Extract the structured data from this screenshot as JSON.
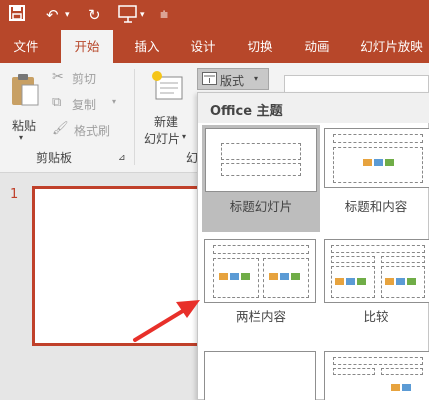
{
  "qat": {
    "save_icon": "save-icon",
    "undo_icon": "undo-icon",
    "redo_icon": "redo-icon",
    "present_icon": "present-from-start-icon",
    "customize_icon": "customize-qat-icon"
  },
  "tabs": [
    {
      "label": "文件"
    },
    {
      "label": "开始"
    },
    {
      "label": "插入"
    },
    {
      "label": "设计"
    },
    {
      "label": "切换"
    },
    {
      "label": "动画"
    },
    {
      "label": "幻灯片放映"
    }
  ],
  "ribbon": {
    "clipboard": {
      "paste": "粘贴",
      "cut": "剪切",
      "copy": "复制",
      "format_painter": "格式刷",
      "group_label": "剪贴板"
    },
    "slides": {
      "new_slide_line1": "新建",
      "new_slide_line2": "幻灯片",
      "layout": "版式",
      "group_label_partial": "幻"
    }
  },
  "slide_panel": {
    "slide_number": "1"
  },
  "layout_menu": {
    "title": "Office 主题",
    "items": [
      {
        "label": "标题幻灯片",
        "selected": true
      },
      {
        "label": "标题和内容",
        "selected": false
      },
      {
        "label": "两栏内容",
        "selected": false
      },
      {
        "label": "比较",
        "selected": false
      }
    ]
  },
  "colors": {
    "accent": "#b7472a",
    "arrow": "#e8302a",
    "selection": "#bdbdbd"
  }
}
